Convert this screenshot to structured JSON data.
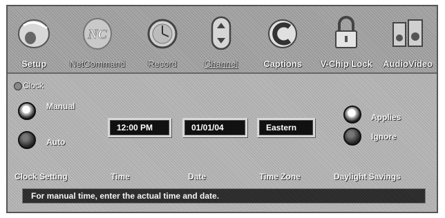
{
  "menu": {
    "items": [
      {
        "label": "Setup",
        "icon": "setup-icon"
      },
      {
        "label": "NetCommand",
        "icon": "netcommand-icon"
      },
      {
        "label": "Record",
        "icon": "record-clock-icon"
      },
      {
        "label": "Channel",
        "icon": "channel-updown-icon"
      },
      {
        "label": "Captions",
        "icon": "captions-icon"
      },
      {
        "label": "V-Chip Lock",
        "icon": "padlock-icon"
      },
      {
        "label": "AudioVideo",
        "icon": "speakers-icon"
      }
    ]
  },
  "clock": {
    "section_title": "Clock",
    "mode_manual": "Manual",
    "mode_auto": "Auto",
    "time_value": "12:00 PM",
    "date_value": "01/01/04",
    "timezone_value": "Eastern",
    "dst_applies": "Applies",
    "dst_ignore": "Ignore"
  },
  "columns": {
    "clock_setting": "Clock Setting",
    "time": "Time",
    "date": "Date",
    "time_zone": "Time Zone",
    "daylight_savings": "Daylight Savings"
  },
  "status_message": "For manual time, enter the actual time and date.",
  "colors": {
    "panel_gray": "#b9b9b9",
    "field_bg": "#111111",
    "text": "#f4f4f4"
  }
}
